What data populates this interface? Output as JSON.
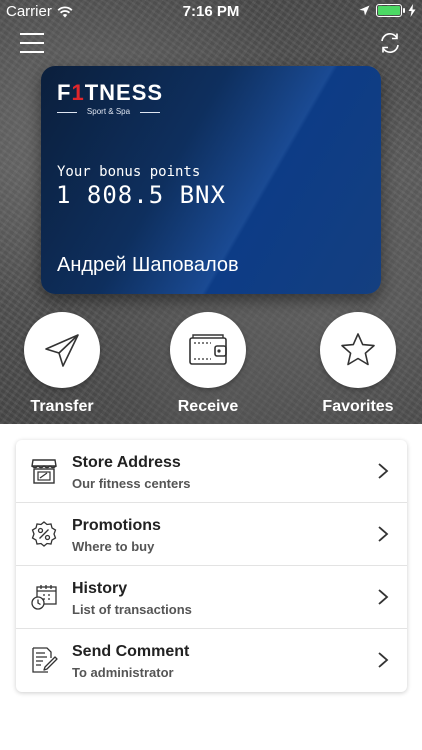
{
  "status_bar": {
    "carrier": "Carrier",
    "time": "7:16 PM"
  },
  "card": {
    "brand_prefix": "F",
    "brand_one": "1",
    "brand_suffix": "TNESS",
    "brand_subtitle": "Sport & Spa",
    "bonus_label": "Your bonus points",
    "bonus_value": "1 808.5 BNX",
    "holder_name": "Андрей Шаповалов"
  },
  "actions": [
    {
      "label": "Transfer",
      "icon": "paper-plane-icon"
    },
    {
      "label": "Receive",
      "icon": "wallet-icon"
    },
    {
      "label": "Favorites",
      "icon": "star-icon"
    }
  ],
  "menu": [
    {
      "title": "Store Address",
      "subtitle": "Our fitness centers",
      "icon": "store-icon"
    },
    {
      "title": "Promotions",
      "subtitle": "Where to buy",
      "icon": "percent-badge-icon"
    },
    {
      "title": "History",
      "subtitle": "List of transactions",
      "icon": "calendar-clock-icon"
    },
    {
      "title": "Send Comment",
      "subtitle": "To administrator",
      "icon": "edit-document-icon"
    }
  ],
  "colors": {
    "accent_red": "#e0262b",
    "card_blue": "#0e2f5e",
    "battery_green": "#4cd964"
  }
}
